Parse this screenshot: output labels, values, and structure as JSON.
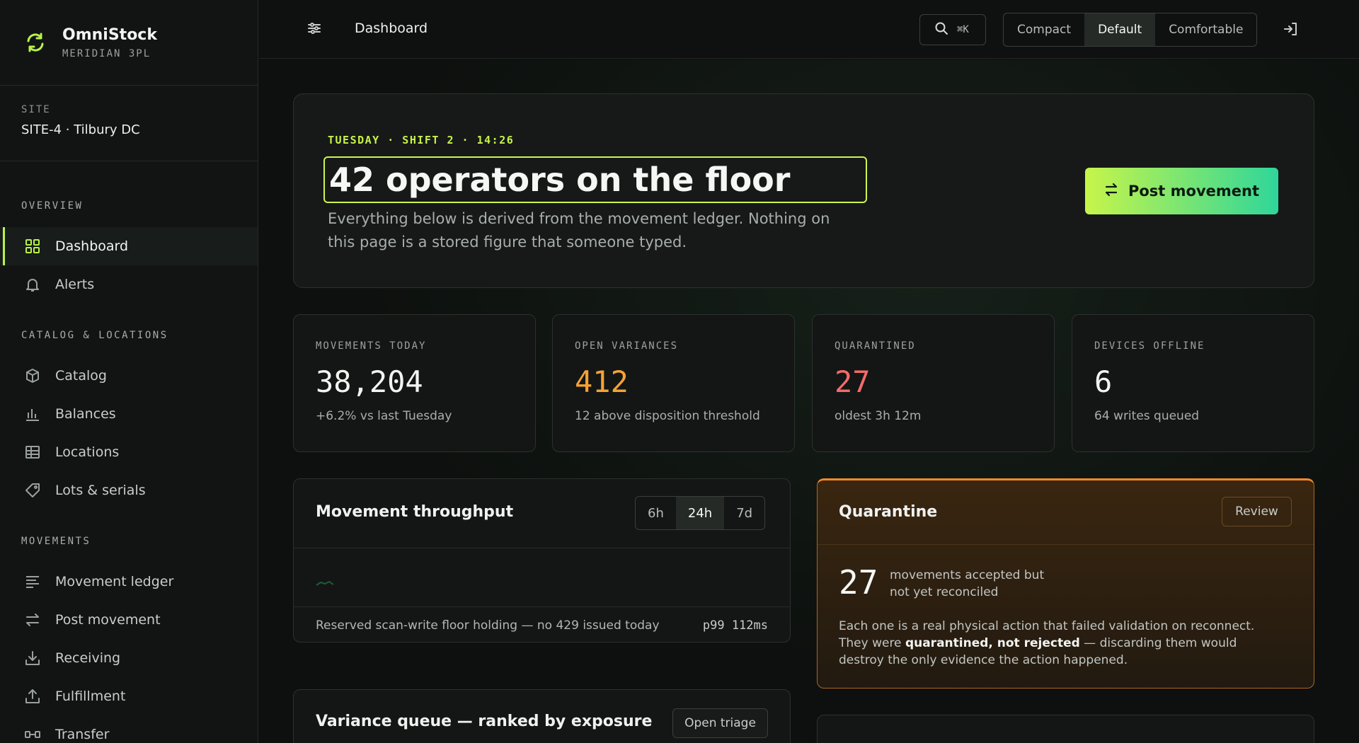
{
  "brand": {
    "name": "OmniStock",
    "subtitle": "MERIDIAN 3PL"
  },
  "site": {
    "label": "SITE",
    "value": "SITE-4 · Tilbury DC"
  },
  "nav": {
    "overview_label": "OVERVIEW",
    "catalog_label": "CATALOG & LOCATIONS",
    "movements_label": "MOVEMENTS",
    "items": [
      {
        "label": "Dashboard",
        "icon": "grid-icon",
        "active": true
      },
      {
        "label": "Alerts",
        "icon": "bell-icon"
      },
      {
        "label": "Catalog",
        "icon": "box-icon"
      },
      {
        "label": "Balances",
        "icon": "bar-chart-icon"
      },
      {
        "label": "Locations",
        "icon": "table-icon"
      },
      {
        "label": "Lots & serials",
        "icon": "tag-icon"
      },
      {
        "label": "Movement ledger",
        "icon": "lines-icon"
      },
      {
        "label": "Post movement",
        "icon": "swap-icon"
      },
      {
        "label": "Receiving",
        "icon": "download-icon"
      },
      {
        "label": "Fulfillment",
        "icon": "upload-icon"
      },
      {
        "label": "Transfer",
        "icon": "transfer-icon"
      }
    ]
  },
  "topbar": {
    "title": "Dashboard",
    "search_shortcut": "⌘K",
    "density": [
      "Compact",
      "Default",
      "Comfortable"
    ],
    "density_selected": "Default"
  },
  "hero": {
    "eyebrow": "TUESDAY · SHIFT 2 · 14:26",
    "title": "42 operators on the floor",
    "description": "Everything below is derived from the movement ledger. Nothing on this page is a stored figure that someone typed.",
    "cta": "Post movement"
  },
  "kpis": [
    {
      "label": "MOVEMENTS TODAY",
      "value": "38,204",
      "sub": "+6.2% vs last Tuesday",
      "color": "#f2f4f2"
    },
    {
      "label": "OPEN VARIANCES",
      "value": "412",
      "sub": "12 above disposition threshold",
      "color": "#f5a236"
    },
    {
      "label": "QUARANTINED",
      "value": "27",
      "sub": "oldest 3h 12m",
      "color": "#f26b6b"
    },
    {
      "label": "DEVICES OFFLINE",
      "value": "6",
      "sub": "64 writes queued",
      "color": "#f2f4f2"
    }
  ],
  "throughput": {
    "title": "Movement throughput",
    "ranges": [
      "6h",
      "24h",
      "7d"
    ],
    "range_selected": "24h",
    "footer": "Reserved scan-write floor holding — no 429 issued today",
    "p99_label": "p99",
    "p99_value": "112ms"
  },
  "quarantine": {
    "title": "Quarantine",
    "review_label": "Review",
    "count": "27",
    "count_caption_1": "movements accepted but",
    "count_caption_2": "not yet reconciled",
    "text_1": "Each one is a real physical action that failed validation on reconnect. They were ",
    "text_bold": "quarantined, not rejected",
    "text_2": " — discarding them would destroy the only evidence the action happened."
  },
  "variance": {
    "title": "Variance queue — ranked by exposure",
    "action": "Open triage"
  },
  "colors": {
    "accent": "#b7f24a",
    "warning": "#f5a236",
    "danger": "#f26b6b"
  }
}
